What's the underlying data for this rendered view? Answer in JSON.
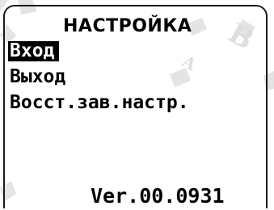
{
  "screen": {
    "title": "НАСТРОЙКА",
    "menu": [
      {
        "label": "Вход",
        "selected": true
      },
      {
        "label": "Выход",
        "selected": false
      },
      {
        "label": "Восст.зав.настр.",
        "selected": false
      }
    ],
    "version": "Ver.00.0931"
  },
  "colors": {
    "text": "#000000",
    "background": "#ffffff",
    "selection_bg": "#000000",
    "selection_text": "#ffffff",
    "watermark": "#d7d7d7"
  }
}
